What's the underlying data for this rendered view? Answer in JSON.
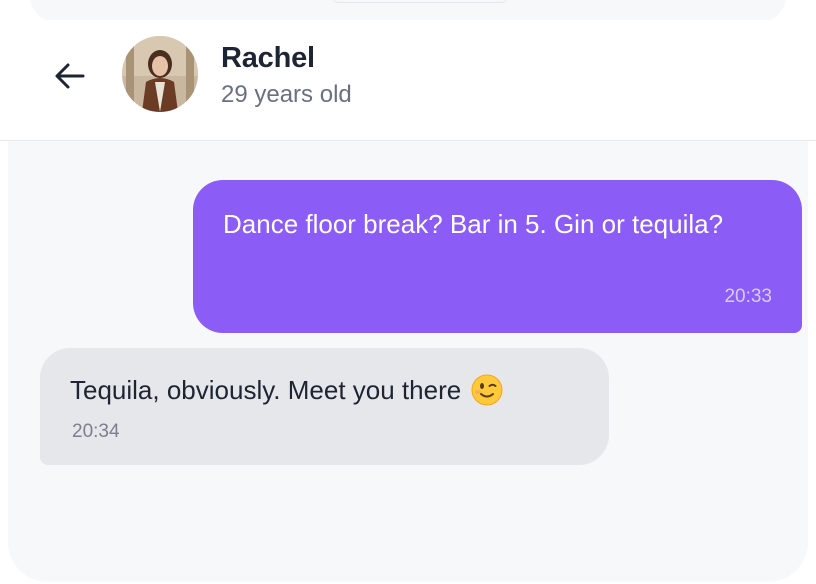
{
  "header": {
    "name": "Rachel",
    "age": "29 years old",
    "back_icon": "arrow-left-icon",
    "avatar_icon": "profile-photo"
  },
  "messages": [
    {
      "direction": "outgoing",
      "text": "Dance floor break? Bar in 5. Gin or tequila?",
      "time": "20:33"
    },
    {
      "direction": "incoming",
      "text": "Tequila, obviously. Meet you there",
      "emoji": "winking-face-emoji",
      "time": "20:34"
    }
  ],
  "colors": {
    "outgoing_bubble": "#8b5cf6",
    "incoming_bubble": "#e6e7eb",
    "chat_background": "#f7f8fa"
  }
}
